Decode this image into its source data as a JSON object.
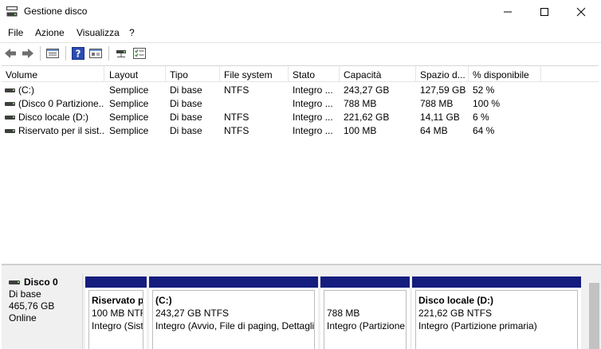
{
  "window": {
    "title": "Gestione disco"
  },
  "menu": {
    "items": [
      "File",
      "Azione",
      "Visualizza",
      "?"
    ]
  },
  "toolbar": {
    "buttons": [
      "back-icon",
      "forward-icon",
      "list-view-icon",
      "help-icon",
      "properties-icon",
      "connect-icon",
      "checklist-icon"
    ]
  },
  "table": {
    "headers": [
      "Volume",
      "Layout",
      "Tipo",
      "File system",
      "Stato",
      "Capacità",
      "Spazio d...",
      "% disponibile"
    ],
    "rows": [
      [
        "(C:)",
        "Semplice",
        "Di base",
        "NTFS",
        "Integro ...",
        "243,27 GB",
        "127,59 GB",
        "52 %"
      ],
      [
        "(Disco 0 Partizione...",
        "Semplice",
        "Di base",
        "",
        "Integro ...",
        "788 MB",
        "788 MB",
        "100 %"
      ],
      [
        "Disco locale (D:)",
        "Semplice",
        "Di base",
        "NTFS",
        "Integro ...",
        "221,62 GB",
        "14,11 GB",
        "6 %"
      ],
      [
        "Riservato per il sist...",
        "Semplice",
        "Di base",
        "NTFS",
        "Integro ...",
        "100 MB",
        "64 MB",
        "64 %"
      ]
    ]
  },
  "disk": {
    "name": "Disco 0",
    "type": "Di base",
    "size": "465,76 GB",
    "status": "Online",
    "partitions": [
      {
        "name": "Riservato p",
        "size": "100 MB NTF",
        "status": "Integro (Sist"
      },
      {
        "name": "(C:)",
        "size": "243,27 GB NTFS",
        "status": "Integro (Avvio, File di paging, Dettagli"
      },
      {
        "name": "",
        "size": "788 MB",
        "status": "Integro (Partizione"
      },
      {
        "name": "Disco locale  (D:)",
        "size": "221,62 GB NTFS",
        "status": "Integro (Partizione primaria)"
      }
    ]
  },
  "colors": {
    "partition_bar": "#151d7e",
    "disk_icon_led": "#7ad36a"
  }
}
